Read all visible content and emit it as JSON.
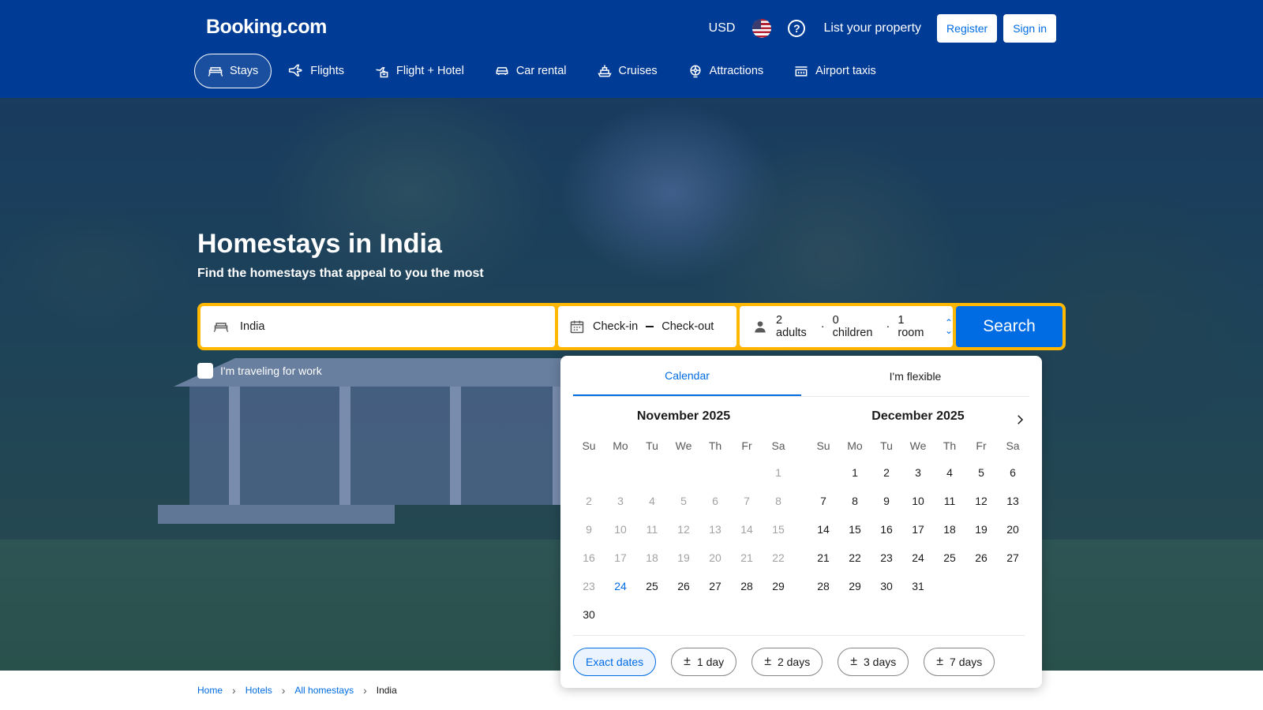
{
  "header": {
    "logo": "Booking.com",
    "currency": "USD",
    "list_property": "List your property",
    "register": "Register",
    "sign_in": "Sign in"
  },
  "nav": [
    {
      "label": "Stays",
      "icon": "bed-icon",
      "active": true
    },
    {
      "label": "Flights",
      "icon": "plane-icon",
      "active": false
    },
    {
      "label": "Flight + Hotel",
      "icon": "flight-hotel-icon",
      "active": false
    },
    {
      "label": "Car rental",
      "icon": "car-icon",
      "active": false
    },
    {
      "label": "Cruises",
      "icon": "ship-icon",
      "active": false
    },
    {
      "label": "Attractions",
      "icon": "attractions-icon",
      "active": false
    },
    {
      "label": "Airport taxis",
      "icon": "taxi-icon",
      "active": false
    }
  ],
  "hero": {
    "title": "Homestays in India",
    "subtitle": "Find the homestays that appeal to you the most"
  },
  "search": {
    "destination": "India",
    "checkin": "Check-in",
    "checkout": "Check-out",
    "adults": "2 adults",
    "children": "0 children",
    "rooms": "1 room",
    "separator": "·",
    "button": "Search",
    "work_label": "I'm traveling for work"
  },
  "calendar": {
    "tabs": [
      "Calendar",
      "I'm flexible"
    ],
    "weekdays": [
      "Su",
      "Mo",
      "Tu",
      "We",
      "Th",
      "Fr",
      "Sa"
    ],
    "months": [
      {
        "title": "November 2025",
        "lead_blanks": 6,
        "days": 30,
        "past_until": 23,
        "today": 24
      },
      {
        "title": "December 2025",
        "lead_blanks": 1,
        "days": 31,
        "past_until": 0,
        "today": 0
      }
    ],
    "chips": [
      {
        "label": "Exact dates",
        "prefix": ""
      },
      {
        "label": "1 day",
        "prefix": "±"
      },
      {
        "label": "2 days",
        "prefix": "±"
      },
      {
        "label": "3 days",
        "prefix": "±"
      },
      {
        "label": "7 days",
        "prefix": "±"
      }
    ]
  },
  "breadcrumb": [
    "Home",
    "Hotels",
    "All homestays",
    "India"
  ],
  "colors": {
    "brand": "#003b95",
    "accent": "#006ce4",
    "search_border": "#ffb700"
  }
}
